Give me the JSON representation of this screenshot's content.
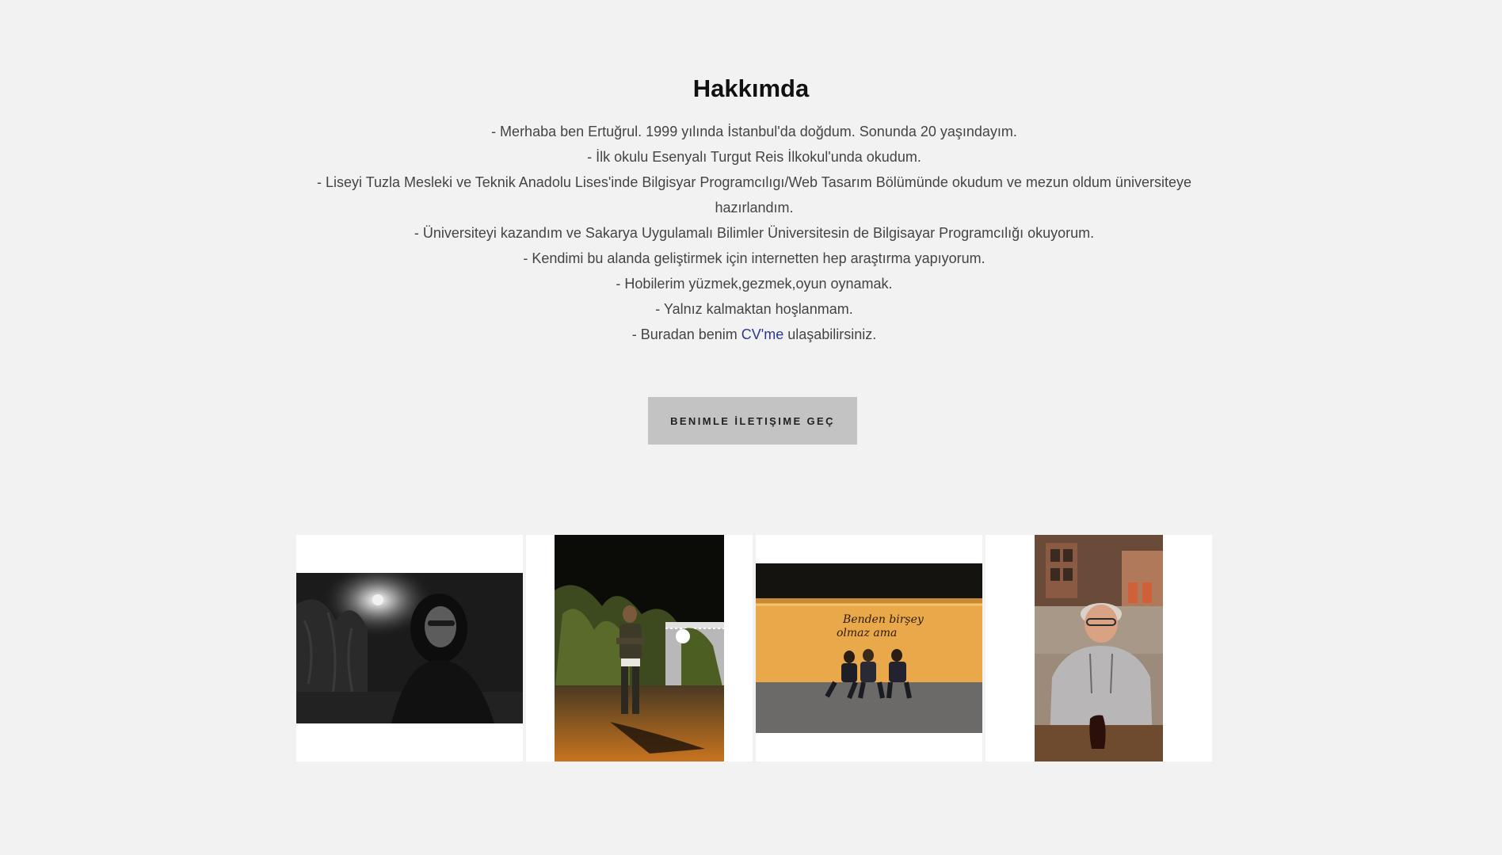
{
  "about": {
    "title": "Hakkımda",
    "lines": [
      "- Merhaba ben Ertuğrul. 1999 yılında İstanbul'da doğdum. Sonunda 20 yaşındayım.",
      "- İlk okulu Esenyalı Turgut Reis İlkokul'unda okudum.",
      "- Liseyi Tuzla Mesleki ve Teknik Anadolu Lises'inde Bilgisyar Programcılıgı/Web Tasarım Bölümünde okudum ve mezun oldum üniversiteye hazırlandım.",
      "- Üniversiteyi kazandım ve Sakarya Uygulamalı Bilimler Üniversitesin de Bilgisayar Programcılığı okuyorum.",
      "- Kendimi bu alanda geliştirmek için internetten hep araştırma yapıyorum.",
      "- Hobilerim yüzmek,gezmek,oyun oynamak.",
      "- Yalnız kalmaktan hoşlanmam."
    ],
    "cv_line": {
      "before": "- Buradan benim ",
      "link": "CV'me",
      "after": " ulaşabilirsiniz."
    },
    "contact_button": "BENIMLE İLETIŞIME GEÇ"
  },
  "gallery": {
    "photos": [
      {
        "subject": "hooded person at night, black and white"
      },
      {
        "subject": "person standing on a street at night"
      },
      {
        "subject": "three people sitting by a wall at night",
        "wall_text": [
          "Benden birşey",
          "olmaz ama"
        ]
      },
      {
        "subject": "person in a grey hoodie at a table"
      }
    ]
  },
  "colors": {
    "page_background": "#f2f2f2",
    "button_background": "#c3c3c3",
    "link": "#2a3a8c",
    "tile_background": "#ffffff"
  }
}
